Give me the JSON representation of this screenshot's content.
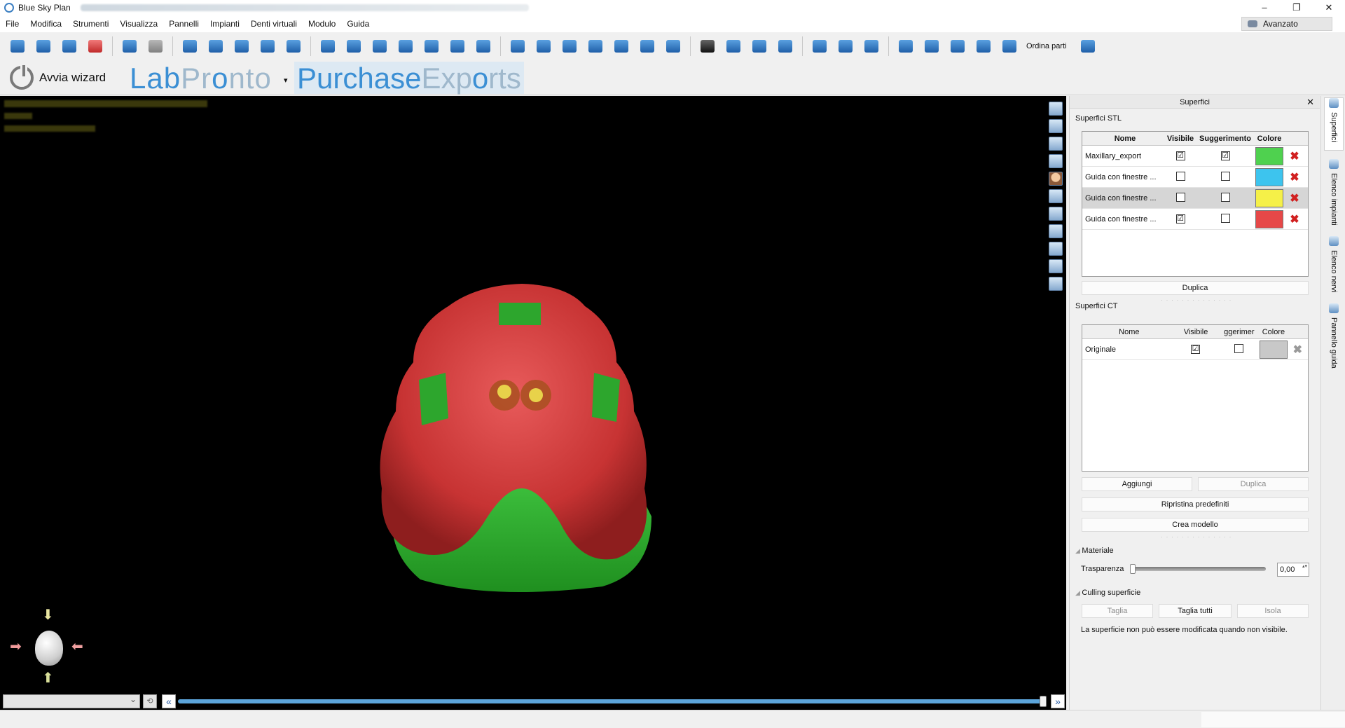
{
  "window": {
    "title": "Blue Sky Plan",
    "controls": [
      "–",
      "❐",
      "✕"
    ]
  },
  "menu": [
    "File",
    "Modifica",
    "Strumenti",
    "Visualizza",
    "Pannelli",
    "Impianti",
    "Denti virtuali",
    "Modulo",
    "Guida"
  ],
  "mode": {
    "label": "Avanzato"
  },
  "toolbar": {
    "order_parts_label": "Ordina parti"
  },
  "wizard": {
    "label": "Avvia wizard"
  },
  "brand": {
    "labpronto_a": "Lab",
    "labpronto_b": "Pr",
    "labpronto_c": "o",
    "labpronto_d": "nto",
    "purchase_a": "Purchase",
    "purchase_b": "Exp",
    "purchase_c": "o",
    "purchase_d": "rts",
    "accent": "#3b8fd4"
  },
  "panel": {
    "title": "Superfici",
    "stl": {
      "title": "Superfici STL",
      "headers": {
        "name": "Nome",
        "visible": "Visibile",
        "hint": "Suggerimento",
        "color": "Colore"
      },
      "rows": [
        {
          "name": "Maxillary_export",
          "visible": "☑",
          "hint": "☑",
          "color": "#4fd14f"
        },
        {
          "name": "Guida con finestre ...",
          "visible": "",
          "hint": "",
          "color": "#3dc4ee"
        },
        {
          "name": "Guida con finestre ...",
          "visible": "",
          "hint": "",
          "color": "#f5f048"
        },
        {
          "name": "Guida con finestre ...",
          "visible": "☑",
          "hint": "",
          "color": "#e64848"
        }
      ],
      "duplicate_label": "Duplica"
    },
    "ct": {
      "title": "Superfici CT",
      "headers": {
        "name": "Nome",
        "visible": "Visibile",
        "hint": "ggerimer",
        "color": "Colore"
      },
      "rows": [
        {
          "name": "Originale",
          "visible": "☑",
          "hint": "",
          "color": "#c8c8c8"
        }
      ],
      "add_label": "Aggiungi",
      "duplicate_label": "Duplica",
      "restore_label": "Ripristina predefiniti",
      "create_model_label": "Crea modello"
    },
    "material": {
      "title": "Materiale",
      "transparency_label": "Trasparenza",
      "transparency_value": "0,00"
    },
    "culling": {
      "title": "Culling superficie",
      "cut_label": "Taglia",
      "cut_all_label": "Taglia tutti",
      "isolate_label": "Isola",
      "note": "La superficie non può essere modificata quando non visibile."
    }
  },
  "side_tabs": [
    "Superfici",
    "Elenco impianti",
    "Elenco nervi",
    "Pannello guida"
  ],
  "viewer": {
    "timeline_position": 1.0
  }
}
